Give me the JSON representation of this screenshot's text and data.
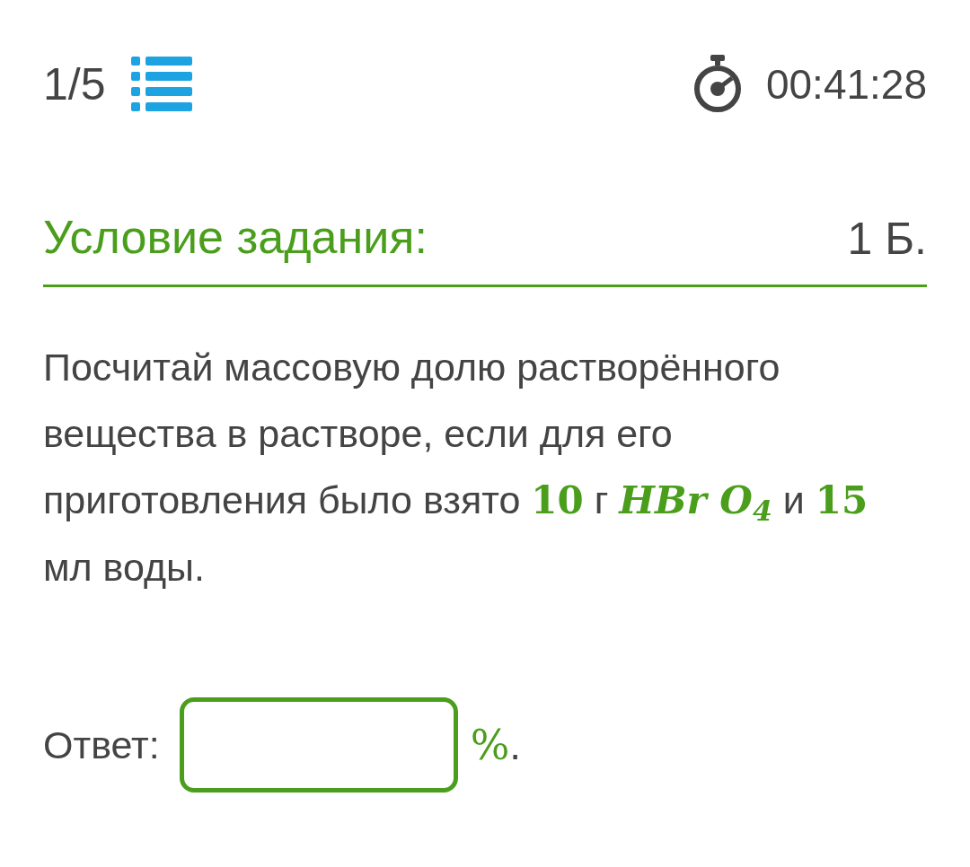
{
  "header": {
    "progress": "1/5",
    "timer": "00:41:28"
  },
  "task": {
    "title": "Условие задания:",
    "points": "1 Б.",
    "segments": [
      {
        "kind": "text",
        "text": "Посчитай массовую долю растворённого вещества в растворе, если для его приготовления было взято "
      },
      {
        "kind": "number",
        "text": "10"
      },
      {
        "kind": "text",
        "text": " г "
      },
      {
        "kind": "formula",
        "text": "*HBr* *O*$_{4}$"
      },
      {
        "kind": "text",
        "text": " и "
      },
      {
        "kind": "number",
        "text": "15"
      },
      {
        "kind": "text",
        "text": " мл воды."
      }
    ]
  },
  "answer": {
    "label": "Ответ:",
    "unit": "%",
    "end": "."
  }
}
